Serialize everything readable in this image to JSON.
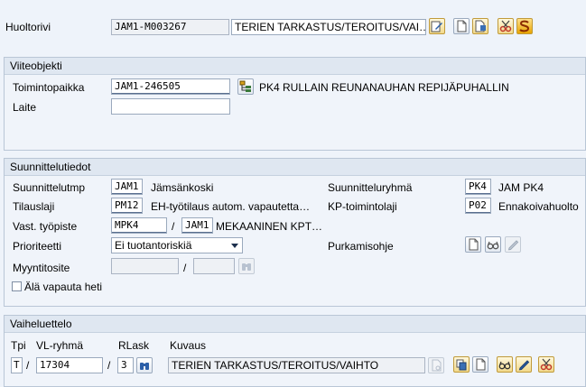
{
  "header": {
    "label": "Huoltorivi",
    "order_value": "JAM1-M003267",
    "description_value": "TERIEN TARKASTUS/TEROITUS/VAI…"
  },
  "reference": {
    "title": "Viiteobjekti",
    "location_label": "Toimintopaikka",
    "location_value": "JAM1-246505",
    "location_description": "PK4 RULLAIN REUNANAUHAN REPIJÄPUHALLIN",
    "device_label": "Laite",
    "device_value": ""
  },
  "planning": {
    "title": "Suunnittelutiedot",
    "plant_label": "Suunnittelutmp",
    "plant_value": "JAM1",
    "plant_text": "Jämsänkoski",
    "group_label": "Suunnitteluryhmä",
    "group_value": "PK4",
    "group_text": "JAM PK4",
    "order_type_label": "Tilauslaji",
    "order_type_value": "PM12",
    "order_type_text": "EH-työtilaus autom. vapautetta…",
    "activity_label": "KP-toimintolaji",
    "activity_value": "P02",
    "activity_text": "Ennakoivahuolto",
    "workcenter_label": "Vast. työpiste",
    "workcenter_value": "MPK4",
    "workcenter_separator": "/",
    "workcenter_plant": "JAM1",
    "workcenter_text": "MEKAANINEN KPT…",
    "priority_label": "Prioriteetti",
    "priority_value": "Ei tuotantoriskiä",
    "disassembly_label": "Purkamisohje",
    "sales_doc_label": "Myyntitosite",
    "sales_doc_value": "",
    "sales_doc_separator": "/",
    "sales_doc_item": "",
    "no_release_label": "Älä vapauta heti"
  },
  "operations": {
    "title": "Vaiheluettelo",
    "col_type": "Tpi",
    "col_group": "VL-ryhmä",
    "col_counter": "RLask",
    "col_description": "Kuvaus",
    "type_value": "T",
    "separator_1": "/",
    "group_value": "17304",
    "separator_2": "/",
    "counter_value": "3",
    "description_value": "TERIEN TARKASTUS/TEROITUS/VAIHTO"
  },
  "colors": {
    "background": "#eef3fa",
    "frame_header": "#dfe7f1",
    "button_accent": "#f2d98c"
  }
}
